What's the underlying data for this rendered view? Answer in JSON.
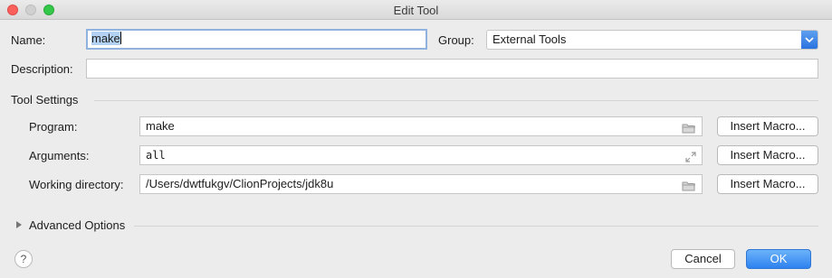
{
  "window": {
    "title": "Edit Tool"
  },
  "name": {
    "label": "Name:",
    "value": "make"
  },
  "group": {
    "label": "Group:",
    "value": "External Tools"
  },
  "description": {
    "label": "Description:",
    "value": ""
  },
  "tool_settings": {
    "title": "Tool Settings",
    "program": {
      "label": "Program:",
      "value": "make",
      "icon": "folder-icon"
    },
    "arguments": {
      "label": "Arguments:",
      "value": "all",
      "icon": "expand-icon"
    },
    "working_directory": {
      "label": "Working directory:",
      "value": "/Users/dwtfukgv/ClionProjects/jdk8u",
      "icon": "folder-icon"
    },
    "insert_macro_label": "Insert Macro..."
  },
  "advanced": {
    "label": "Advanced Options"
  },
  "footer": {
    "help_label": "?",
    "cancel_label": "Cancel",
    "ok_label": "OK"
  },
  "colors": {
    "accent": "#2e82f0",
    "focus": "#8fb2de",
    "selection": "#b3d2f3"
  }
}
